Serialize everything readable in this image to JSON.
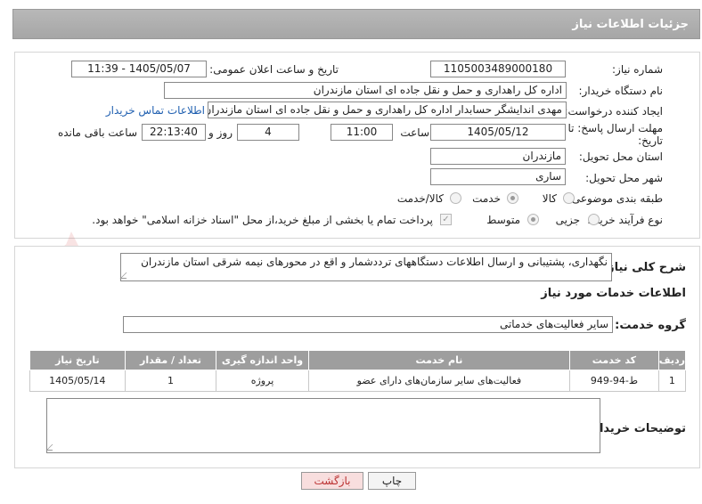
{
  "header": {
    "title": "جزئیات اطلاعات نیاز"
  },
  "form": {
    "need_number_label": "شماره نیاز:",
    "need_number": "1105003489000180",
    "announce_label": "تاریخ و ساعت اعلان عمومی:",
    "announce_value": "1405/05/07 - 11:39",
    "buyer_org_label": "نام دستگاه خریدار:",
    "buyer_org": "اداره کل راهداری و حمل و نقل جاده ای استان مازندران",
    "creator_label": "ایجاد کننده درخواست:",
    "creator": "مهدی اندایشگر حسابدار اداره کل راهداری و حمل و نقل جاده ای استان مازندران",
    "contact_link": "اطلاعات تماس خریدار",
    "deadline_label_line1": "مهلت ارسال پاسخ: تا",
    "deadline_label_line2": "تاریخ:",
    "deadline_date": "1405/05/12",
    "time_label": "ساعت",
    "deadline_time": "11:00",
    "days_value": "4",
    "days_label": "روز و",
    "remaining_time": "22:13:40",
    "remaining_label": "ساعت باقی مانده",
    "province_label": "استان محل تحویل:",
    "province": "مازندران",
    "city_label": "شهر محل تحویل:",
    "city": "ساری",
    "category_label": "طبقه بندی موضوعی:",
    "category_options": [
      "کالا",
      "خدمت",
      "کالا/خدمت"
    ],
    "process_label": "نوع فرآیند خرید :",
    "process_options": [
      "جزیی",
      "متوسط"
    ],
    "payment_note": "پرداخت تمام یا بخشی از مبلغ خرید،از محل \"اسناد خزانه اسلامی\" خواهد بود."
  },
  "details": {
    "description_label": "شرح کلی نیاز:",
    "description": "نگهداری، پشتیبانی و ارسال اطلاعات دستگاههای ترددشمار و اقع در محورهای نیمه شرقی استان مازندران",
    "services_title": "اطلاعات خدمات مورد نیاز",
    "service_group_label": "گروه خدمت:",
    "service_group": "سایر فعالیت‌های خدماتی",
    "table": {
      "headers": [
        "ردیف",
        "کد خدمت",
        "نام خدمت",
        "واحد اندازه گیری",
        "تعداد / مقدار",
        "تاریخ نیاز"
      ],
      "rows": [
        [
          "1",
          "ط-94-949",
          "فعالیت‌های سایر سازمان‌های دارای عضو",
          "پروژه",
          "1",
          "1405/05/14"
        ]
      ]
    },
    "buyer_notes_label": "توضیحات خریدار:"
  },
  "actions": {
    "print_label": "چاپ",
    "back_label": "بازگشت"
  },
  "colors": {
    "header_bg": "#a6a6a6",
    "table_header_bg": "#9e9e9e",
    "link": "#1f5fb0",
    "back_button_bg": "#f8dede"
  }
}
